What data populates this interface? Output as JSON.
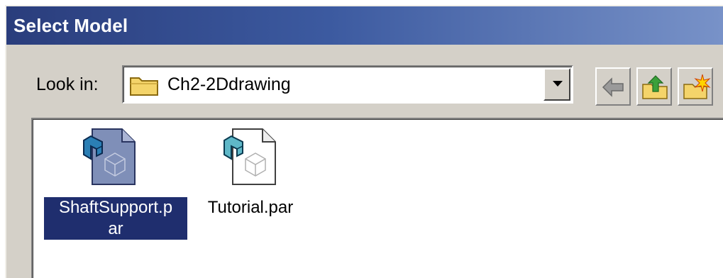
{
  "window": {
    "title": "Select Model"
  },
  "lookin": {
    "label": "Look in:",
    "value": "Ch2-2Ddrawing",
    "icon": "folder-icon"
  },
  "toolbar": {
    "buttons": [
      {
        "name": "back-button",
        "icon": "back-arrow-icon"
      },
      {
        "name": "up-folder-button",
        "icon": "up-folder-icon"
      },
      {
        "name": "new-folder-button",
        "icon": "new-folder-icon"
      }
    ]
  },
  "files": [
    {
      "label_line1": "ShaftSupport.p",
      "label_line2": "ar",
      "selected": true,
      "icon": "part-file-icon"
    },
    {
      "label_line1": "Tutorial.par",
      "selected": false,
      "icon": "part-file-icon"
    }
  ],
  "colors": {
    "selection": "#1f2e6e",
    "titlebar_start": "#2a3d7c",
    "titlebar_end": "#7892c8",
    "dialog_face": "#d4d0c8"
  }
}
